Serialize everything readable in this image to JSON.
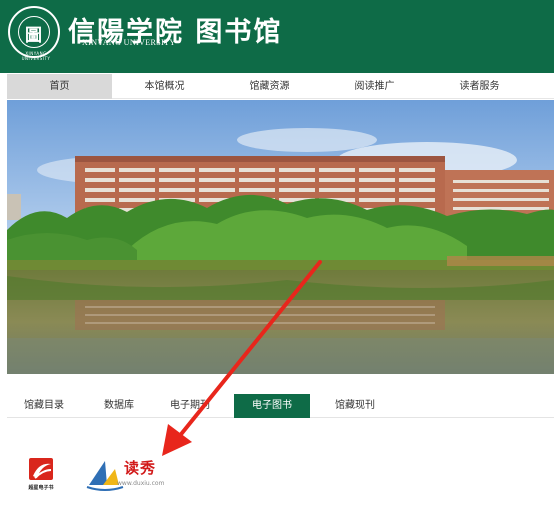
{
  "header": {
    "seal_glyph": "圖",
    "seal_arc": "XINYANG UNIVERSITY",
    "title": "信陽学院 图书馆",
    "subtitle": "XINYANG UNIVERSITY",
    "background": "#0e6b47"
  },
  "nav": {
    "items": [
      {
        "label": "首页"
      },
      {
        "label": "本馆概况"
      },
      {
        "label": "馆藏资源"
      },
      {
        "label": "阅读推广"
      },
      {
        "label": "读者服务"
      }
    ]
  },
  "tabs": {
    "items": [
      {
        "label": "馆藏目录"
      },
      {
        "label": "数据库"
      },
      {
        "label": "电子期刊"
      },
      {
        "label": "电子图书"
      },
      {
        "label": "馆藏现刊"
      }
    ],
    "active": "电子图书"
  },
  "resources": {
    "chaoxing_label": "超星电子书",
    "duxiu_name": "读秀",
    "duxiu_url": "www.duxiu.com"
  },
  "colors": {
    "brand_green": "#0e6b47",
    "annotation_red": "#e8261c"
  }
}
